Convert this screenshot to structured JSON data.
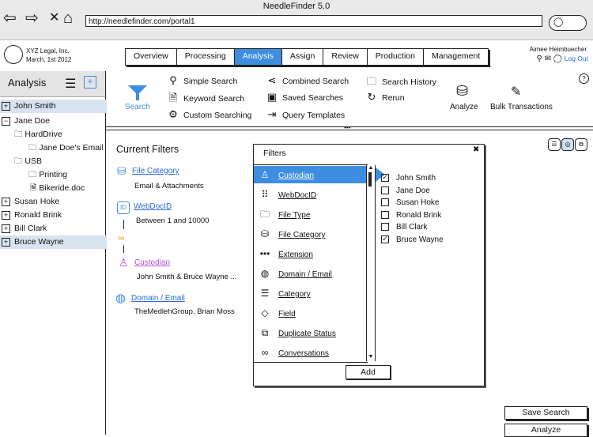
{
  "window": {
    "title": "NeedleFinder 5.0"
  },
  "browser": {
    "url": "http://needlefinder.com/portal1"
  },
  "company": {
    "name": "XYZ Legal, Inc.",
    "date": "March, 1st 2012"
  },
  "nav_tabs": [
    "Overview",
    "Processing",
    "Analysis",
    "Assign",
    "Review",
    "Production",
    "Management"
  ],
  "active_tab": "Analysis",
  "user": {
    "name": "Aimee Heimbuecher",
    "logout": "Log Out"
  },
  "sidebar": {
    "title": "Analysis",
    "tree": [
      {
        "label": "John Smith",
        "toggle": "+",
        "selected": true
      },
      {
        "label": "Jane Doe",
        "toggle": "−",
        "selected": false
      },
      {
        "label": "HardDrive"
      },
      {
        "label": "Jane Doe's Email"
      },
      {
        "label": "USB"
      },
      {
        "label": "Printing"
      },
      {
        "label": "Bikeride.doc"
      },
      {
        "label": "Susan Hoke",
        "toggle": "+",
        "selected": false
      },
      {
        "label": "Ronald Brink",
        "toggle": "+",
        "selected": false
      },
      {
        "label": "Bill Clark",
        "toggle": "+",
        "selected": false
      },
      {
        "label": "Bruce Wayne",
        "toggle": "+",
        "selected": true
      }
    ]
  },
  "toolbar": {
    "search": "Search",
    "simple_search": "Simple Search",
    "keyword_search": "Keyword Search",
    "custom_searching": "Custom Searching",
    "combined_search": "Combined Search",
    "saved_searches": "Saved Searches",
    "query_templates": "Query Templates",
    "search_history": "Search History",
    "rerun": "Rerun",
    "analyze": "Analyze",
    "bulk_transactions": "Bulk Transactions",
    "help": "?"
  },
  "current_filters": {
    "title": "Current Filters",
    "items": [
      {
        "name": "File Category",
        "value": "Email & Attachments"
      },
      {
        "name": "WebDocID",
        "value": "Between 1 and 10000"
      },
      {
        "name": "Custodian",
        "value": "John Smith & Bruce Wayne ..."
      },
      {
        "name": "Domain / Email",
        "value": "TheMedlehGroup, Brian Moss"
      }
    ]
  },
  "filters_dialog": {
    "title": "Filters",
    "close": "✖",
    "list": [
      "Custodian",
      "WebDocID",
      "File Type",
      "File Category",
      "Extension",
      "Domain / Email",
      "Category",
      "Field",
      "Duplicate Status",
      "Conversations"
    ],
    "selected": "Custodian",
    "custodians": [
      {
        "name": "John Smith",
        "checked": true
      },
      {
        "name": "Jane Doe",
        "checked": false
      },
      {
        "name": "Susan Hoke",
        "checked": false
      },
      {
        "name": "Ronald Brink",
        "checked": false
      },
      {
        "name": "Bill Clark",
        "checked": false
      },
      {
        "name": "Bruce Wayne",
        "checked": true
      }
    ],
    "add": "Add"
  },
  "buttons": {
    "save_search": "Save Search",
    "analyze": "Analyze"
  },
  "colors": {
    "accent": "#3d8de0",
    "link": "#2a6ad8",
    "selected_row": "#d7e3ef",
    "purple": "#b64fd6",
    "orange": "#f0a020"
  }
}
